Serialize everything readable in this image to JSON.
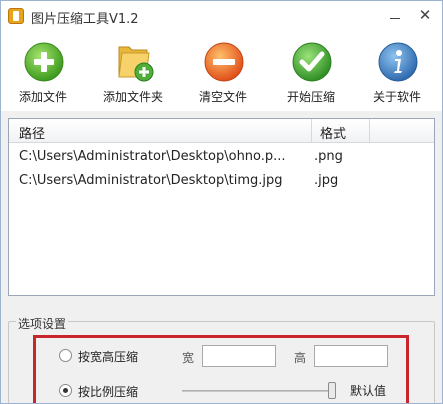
{
  "window": {
    "title": "图片压缩工具V1.2"
  },
  "toolbar": {
    "items": [
      {
        "label": "添加文件",
        "icon": "add-file-icon",
        "color": "#5cb82f"
      },
      {
        "label": "添加文件夹",
        "icon": "add-folder-icon",
        "color": "#e7b53b"
      },
      {
        "label": "清空文件",
        "icon": "clear-files-icon",
        "color": "#e8601c"
      },
      {
        "label": "开始压缩",
        "icon": "start-compress-icon",
        "color": "#4fae3a"
      },
      {
        "label": "关于软件",
        "icon": "about-icon",
        "color": "#3f7fbf"
      }
    ]
  },
  "file_list": {
    "columns": [
      "路径",
      "格式"
    ],
    "rows": [
      {
        "path": "C:\\Users\\Administrator\\Desktop\\ohno.p...",
        "format": ".png"
      },
      {
        "path": "C:\\Users\\Administrator\\Desktop\\timg.jpg",
        "format": ".jpg"
      }
    ]
  },
  "options": {
    "title": "选项设置",
    "resize_by_wh": {
      "label": "按宽高压缩",
      "selected": false
    },
    "width_label": "宽",
    "height_label": "高",
    "width_value": "",
    "height_value": "",
    "resize_by_ratio": {
      "label": "按比例压缩",
      "selected": true
    },
    "ratio_level": 0.97,
    "default_label": "默认值"
  },
  "colors": {
    "highlight_border": "#c8262c"
  }
}
